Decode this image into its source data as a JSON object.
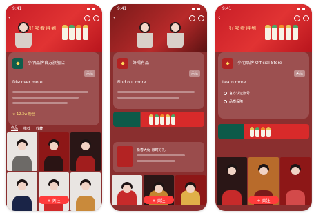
{
  "status": {
    "time": "9:41"
  },
  "banner": {
    "slogan": "好喝看得到"
  },
  "phones": [
    {
      "account_name": "小明品牌官方旗舰店",
      "tag": "关注",
      "subtitle": "Discover more",
      "meta": "★ 12.3w 粉丝",
      "tabs": [
        "作品",
        "推荐",
        "收藏"
      ],
      "follow": "+ 关注"
    },
    {
      "account_name": "好喝有品",
      "tag": "关注",
      "subtitle": "Find out more",
      "mini_title": "新春大促 限时好礼",
      "follow": "+ 关注"
    },
    {
      "account_name": "小明品牌 Official Store",
      "tag": "关注",
      "subtitle": "Learn more",
      "check1": "官方认证账号",
      "check2": "品质保障",
      "follow": "+ 关注"
    }
  ],
  "colors": {
    "brand_red": "#d82a2a",
    "brand_green": "#0d5a49",
    "accent_gold": "#ffd95a"
  }
}
